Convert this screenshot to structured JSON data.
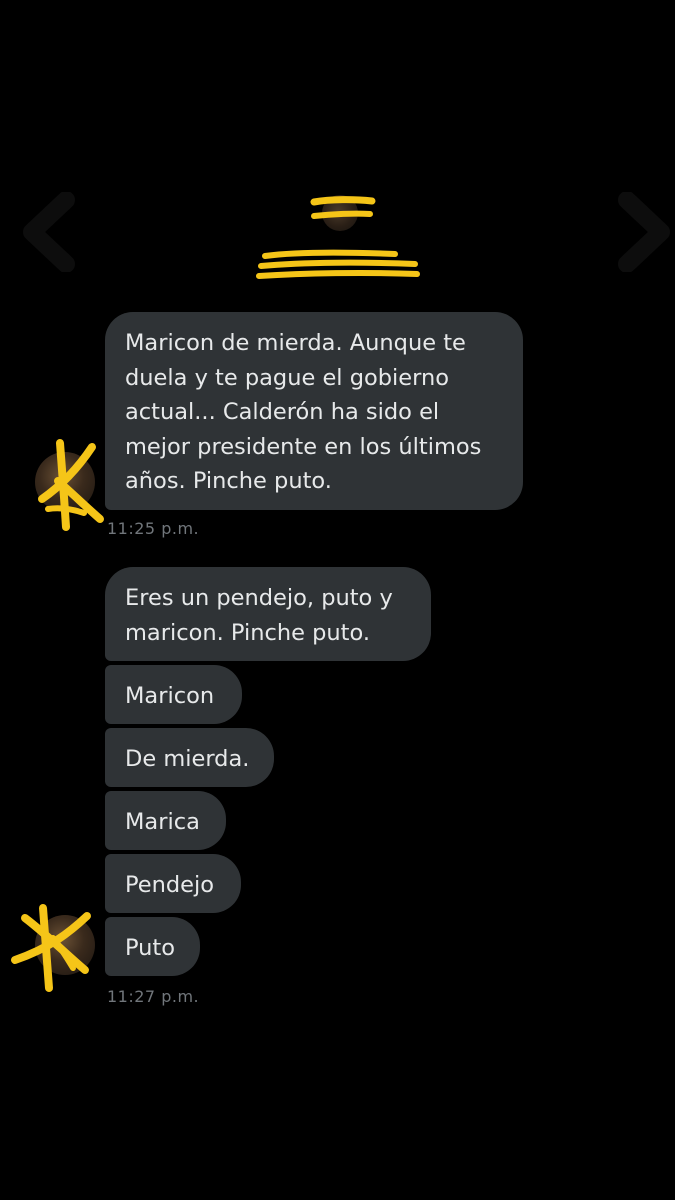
{
  "header": {
    "back_icon": "back-arrow-icon",
    "info_icon": "info-icon"
  },
  "conversation": {
    "group1": {
      "message": "Maricon de mierda. Aunque te duela y te pague el gobierno actual... Calderón ha sido el mejor presidente en los últimos años. Pinche puto.",
      "lines": [
        "Maricon de mierda. Aunque te",
        "duela y te pague el gobierno",
        "actual... Calderón ha sido el",
        "mejor presidente en los últimos",
        "años. Pinche puto."
      ],
      "timestamp": "11:25 p.m."
    },
    "group2": {
      "messages": [
        {
          "lines": [
            "Eres un pendejo, puto y",
            "maricon. Pinche puto."
          ]
        },
        {
          "lines": [
            "Maricon"
          ]
        },
        {
          "lines": [
            "De mierda."
          ]
        },
        {
          "lines": [
            "Marica"
          ]
        },
        {
          "lines": [
            "Pendejo"
          ]
        },
        {
          "lines": [
            "Puto"
          ]
        }
      ],
      "timestamp": "11:27 p.m."
    }
  },
  "colors": {
    "background": "#000000",
    "bubble": "#2f3336",
    "text": "#e7e9ea",
    "timestamp": "#71767b",
    "redaction": "#f5c518"
  }
}
